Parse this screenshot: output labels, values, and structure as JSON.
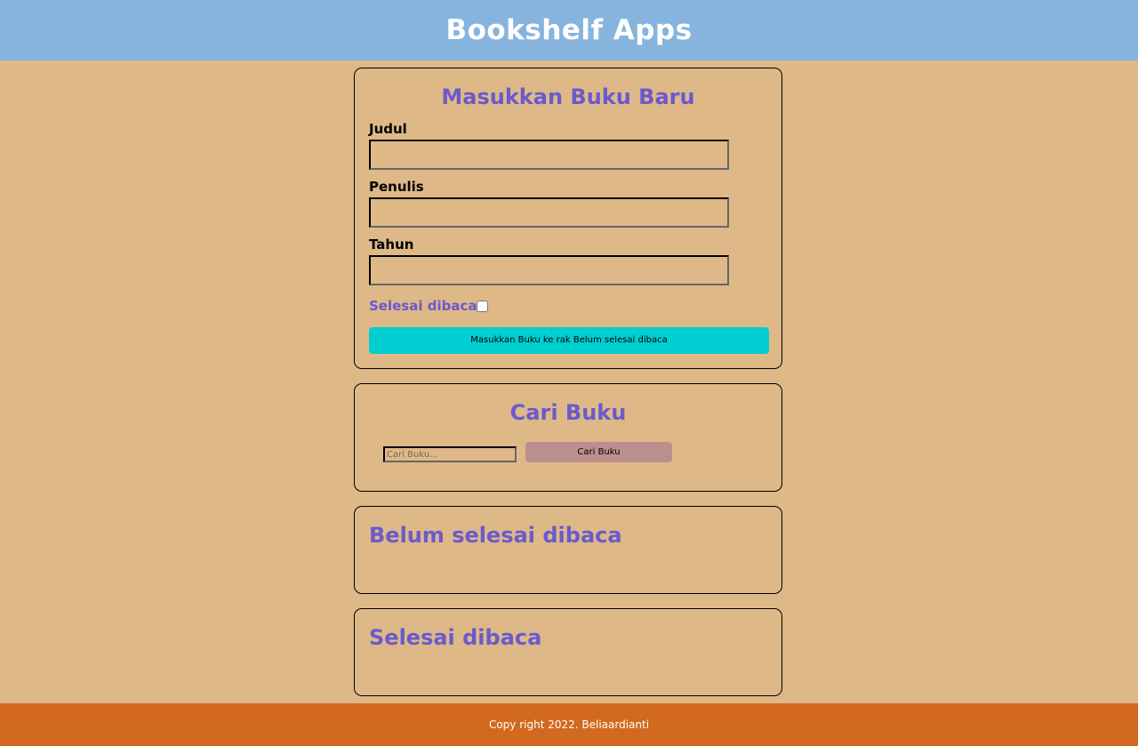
{
  "header": {
    "title": "Bookshelf Apps"
  },
  "input_section": {
    "title": "Masukkan Buku Baru",
    "fields": [
      {
        "label": "Judul",
        "value": ""
      },
      {
        "label": "Penulis",
        "value": ""
      },
      {
        "label": "Tahun",
        "value": ""
      }
    ],
    "checkbox_label": "Selesai dibaca",
    "checkbox_checked": false,
    "submit_prefix": "Masukkan Buku ke rak ",
    "submit_target": "Belum selesai dibaca"
  },
  "search_section": {
    "title": "Cari Buku",
    "placeholder": "Cari Buku...",
    "button_label": "Cari Buku"
  },
  "shelves": {
    "unread_title": "Belum selesai dibaca",
    "read_title": "Selesai dibaca"
  },
  "footer": {
    "text": "Copy right 2022. Beliaardianti"
  },
  "colors": {
    "header_bg": "#87B4DE",
    "page_bg": "#DEB887",
    "accent_text": "#6A5ACD",
    "submit_button": "#00CED1",
    "search_button": "#BC8F8F",
    "footer_bg": "#D2691E"
  }
}
